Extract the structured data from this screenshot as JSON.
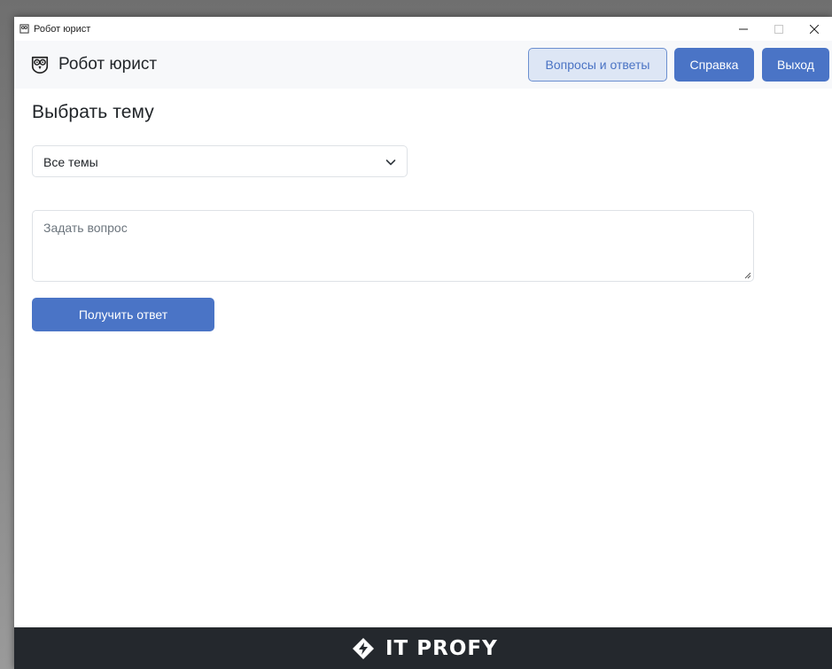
{
  "window": {
    "title": "Робот юрист"
  },
  "navbar": {
    "brand": "Робот юрист",
    "buttons": {
      "faq": "Вопросы и ответы",
      "help": "Справка",
      "exit": "Выход"
    }
  },
  "main": {
    "heading": "Выбрать тему",
    "topic_select": {
      "value": "Все темы"
    },
    "question": {
      "placeholder": "Задать вопрос",
      "value": ""
    },
    "submit_label": "Получить ответ"
  },
  "footer": {
    "logo_text": "IT PROFY"
  },
  "colors": {
    "primary": "#4a74c6",
    "outline_bg": "#dde6f5",
    "navbar_bg": "#f7f8fa",
    "footer_bg": "#24282d"
  },
  "icons": {
    "app": "owl-icon",
    "chevron": "chevron-down-icon",
    "footer_logo": "itprofy-logo-icon"
  }
}
